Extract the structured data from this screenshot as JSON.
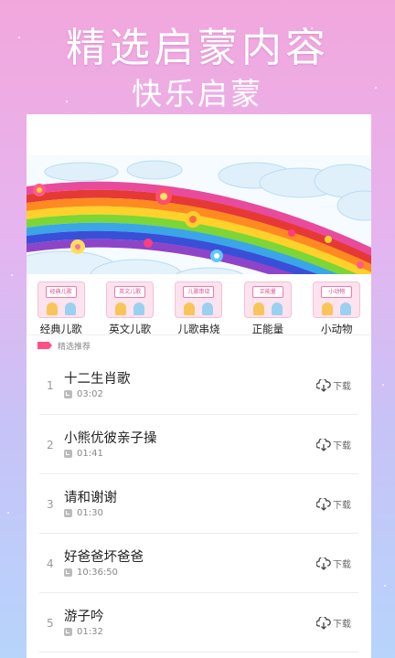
{
  "promo": {
    "title": "精选启蒙内容",
    "subtitle": "快乐启蒙"
  },
  "categories": [
    {
      "label": "经典儿歌",
      "tile_text": "经典儿歌"
    },
    {
      "label": "英文儿歌",
      "tile_text": "英文儿歌"
    },
    {
      "label": "儿歌串烧",
      "tile_text": "儿歌串烧"
    },
    {
      "label": "正能量",
      "tile_text": "正能量"
    },
    {
      "label": "小动物",
      "tile_text": "小动物"
    }
  ],
  "section": {
    "title": "精选推荐"
  },
  "songs": [
    {
      "num": "1",
      "title": "十二生肖歌",
      "duration": "03:02",
      "download": "下载"
    },
    {
      "num": "2",
      "title": "小熊优彼亲子操",
      "duration": "01:41",
      "download": "下载"
    },
    {
      "num": "3",
      "title": "请和谢谢",
      "duration": "01:30",
      "download": "下载"
    },
    {
      "num": "4",
      "title": "好爸爸坏爸爸",
      "duration": "10:36:50",
      "download": "下载"
    },
    {
      "num": "5",
      "title": "游子吟",
      "duration": "01:32",
      "download": "下载"
    }
  ],
  "colors": {
    "accent": "#ff4f84",
    "background_top": "#f2a7dc",
    "background_bottom": "#b7d4fb"
  }
}
